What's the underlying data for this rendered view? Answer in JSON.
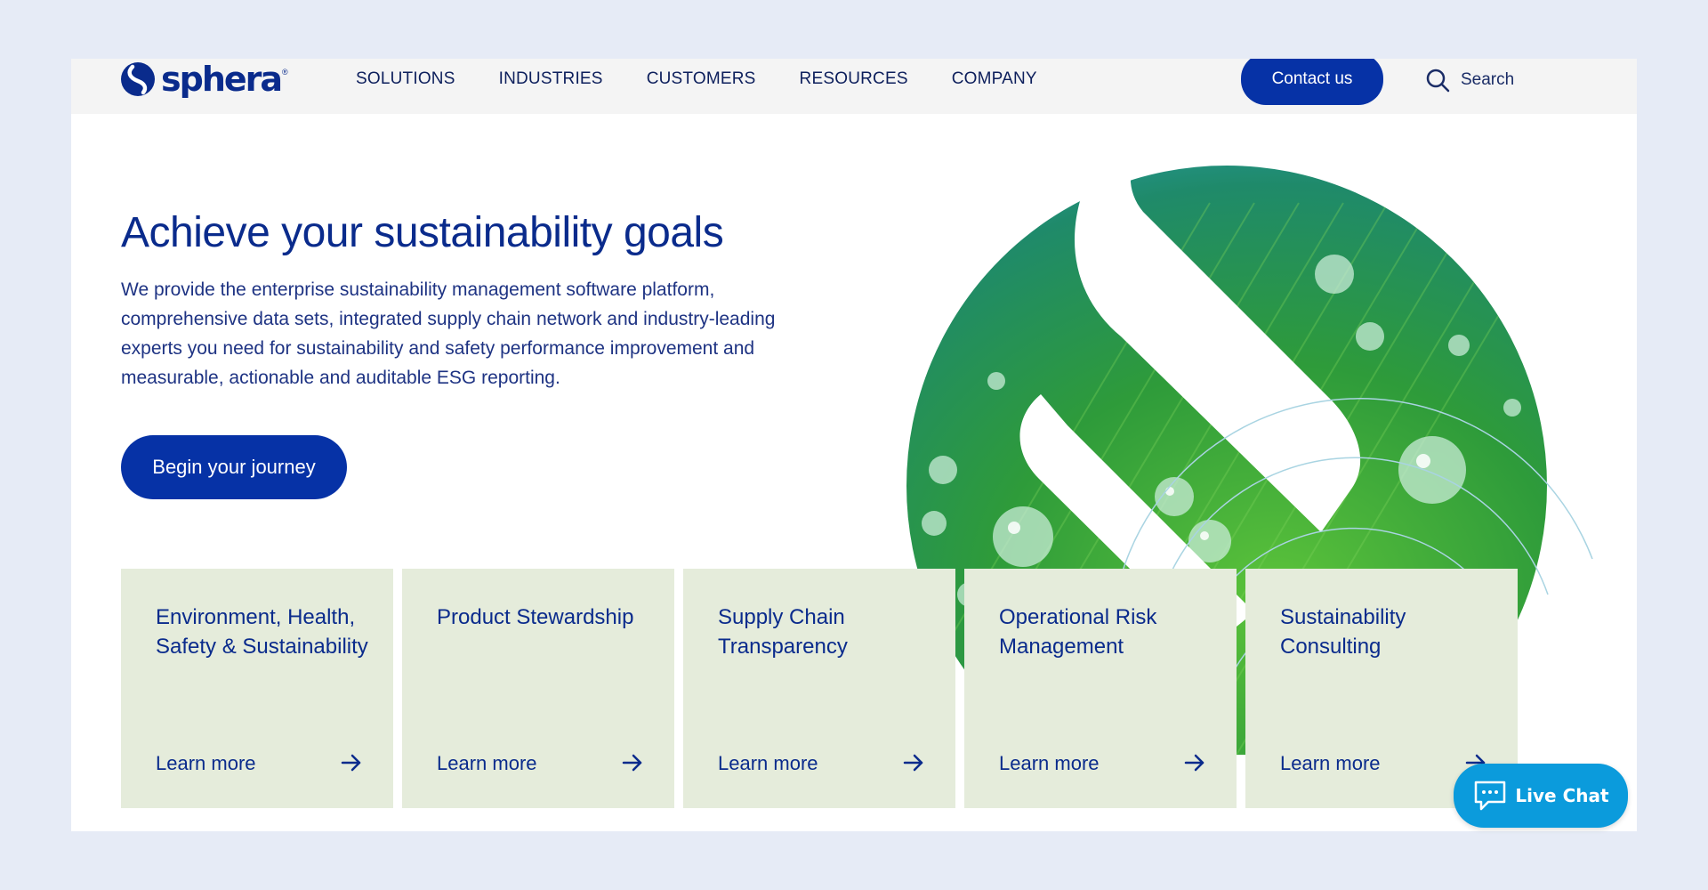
{
  "header": {
    "logo_text": "sphera",
    "logo_tm": "®",
    "nav": [
      "SOLUTIONS",
      "INDUSTRIES",
      "CUSTOMERS",
      "RESOURCES",
      "COMPANY"
    ],
    "contact_label": "Contact us",
    "search_label": "Search"
  },
  "hero": {
    "title": "Achieve your sustainability goals",
    "description": "We provide the enterprise sustainability management software platform, comprehensive data sets, integrated supply chain network and industry-leading experts you need for sustainability and safety performance improvement and measurable, actionable and auditable ESG reporting.",
    "cta_label": "Begin your journey"
  },
  "cards": [
    {
      "title": "Environment, Health, Safety & Sustainability",
      "link": "Learn more"
    },
    {
      "title": "Product Stewardship",
      "link": "Learn more"
    },
    {
      "title": "Supply Chain Transparency",
      "link": "Learn more"
    },
    {
      "title": "Operational Risk Management",
      "link": "Learn more"
    },
    {
      "title": "Sustainability Consulting",
      "link": "Learn more"
    }
  ],
  "live_chat": {
    "label": "Live Chat"
  },
  "colors": {
    "brand_blue": "#0632a6",
    "text_blue": "#0a2b8c",
    "card_bg": "#e5ecdb",
    "chat_blue": "#0b9bdc",
    "page_bg": "#e6ebf6"
  },
  "icons": {
    "search": "search-icon",
    "arrow": "arrow-right-icon",
    "chat": "chat-bubble-icon",
    "logo": "sphera-s-logo-icon"
  }
}
